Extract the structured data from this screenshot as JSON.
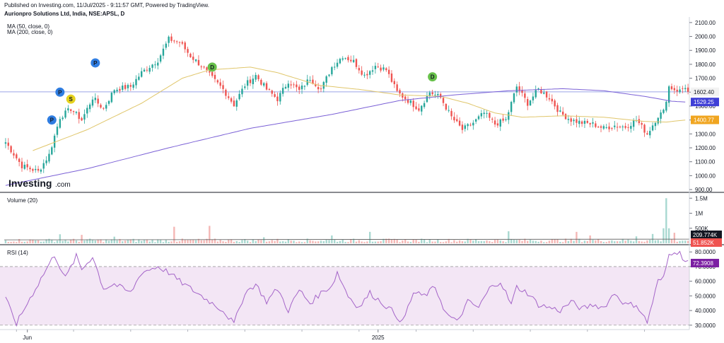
{
  "header": {
    "published": "Published on Investing.com, 11/Jul/2025 - 9:11:57 GMT, Powered by TradingView.",
    "symbol": "Aurionpro Solutions Ltd, India, NSE:APSL, D",
    "ma50": "MA (50, close, 0)",
    "ma200": "MA (200, close, 0)"
  },
  "watermark": {
    "brand": "Investing",
    "suffix": ".com"
  },
  "colors": {
    "up": "#26a69a",
    "down": "#ef5350",
    "ma50": "#e0c66b",
    "ma200": "#7b61d6",
    "rsi": "#a464c8",
    "rsi_band": "#f3e6f5",
    "price_line": "#9aa5e6",
    "lastprice": "#f2f2f2",
    "ma200_tag": "#3f3fd6",
    "ma50_tag": "#f0a520",
    "vol_tag": "#131722",
    "vol_tag2": "#ef5350",
    "rsi_tag": "#7b1fa2"
  },
  "chart_data": [
    {
      "type": "candlestick",
      "panel": "price",
      "ylim": [
        880,
        2140
      ],
      "yticks": [
        "2100.00",
        "2000.00",
        "1900.00",
        "1800.00",
        "1700.00",
        "1600.00",
        "1500.00",
        "1400.00",
        "1300.00",
        "1200.00",
        "1100.00",
        "1000.00",
        "900.00"
      ],
      "ytick_values": [
        2100,
        2000,
        1900,
        1800,
        1700,
        1600,
        1500,
        1400,
        1300,
        1200,
        1100,
        1000,
        900
      ],
      "x_labels": [
        {
          "text": "Jun",
          "index": 8
        },
        {
          "text": "2025",
          "index": 137
        }
      ],
      "bars_total": 252,
      "close_anchors": [
        [
          0,
          1240
        ],
        [
          6,
          1070
        ],
        [
          12,
          1030
        ],
        [
          16,
          1150
        ],
        [
          20,
          1420
        ],
        [
          24,
          1480
        ],
        [
          28,
          1400
        ],
        [
          32,
          1560
        ],
        [
          36,
          1480
        ],
        [
          40,
          1620
        ],
        [
          46,
          1640
        ],
        [
          50,
          1740
        ],
        [
          56,
          1830
        ],
        [
          60,
          1980
        ],
        [
          64,
          1960
        ],
        [
          68,
          1860
        ],
        [
          72,
          1790
        ],
        [
          76,
          1700
        ],
        [
          80,
          1620
        ],
        [
          84,
          1510
        ],
        [
          88,
          1650
        ],
        [
          92,
          1720
        ],
        [
          96,
          1620
        ],
        [
          100,
          1550
        ],
        [
          104,
          1680
        ],
        [
          108,
          1610
        ],
        [
          112,
          1700
        ],
        [
          116,
          1620
        ],
        [
          120,
          1780
        ],
        [
          124,
          1860
        ],
        [
          128,
          1820
        ],
        [
          132,
          1720
        ],
        [
          136,
          1790
        ],
        [
          140,
          1760
        ],
        [
          144,
          1600
        ],
        [
          148,
          1540
        ],
        [
          152,
          1480
        ],
        [
          156,
          1600
        ],
        [
          160,
          1560
        ],
        [
          164,
          1420
        ],
        [
          168,
          1330
        ],
        [
          172,
          1380
        ],
        [
          176,
          1450
        ],
        [
          180,
          1370
        ],
        [
          184,
          1400
        ],
        [
          188,
          1640
        ],
        [
          192,
          1520
        ],
        [
          196,
          1620
        ],
        [
          200,
          1560
        ],
        [
          204,
          1450
        ],
        [
          208,
          1400
        ],
        [
          212,
          1380
        ],
        [
          216,
          1370
        ],
        [
          220,
          1340
        ],
        [
          224,
          1360
        ],
        [
          228,
          1350
        ],
        [
          232,
          1400
        ],
        [
          236,
          1300
        ],
        [
          240,
          1430
        ],
        [
          242,
          1460
        ],
        [
          244,
          1640
        ],
        [
          246,
          1620
        ],
        [
          248,
          1610
        ],
        [
          250,
          1640
        ],
        [
          251,
          1602.4
        ]
      ],
      "markers": [
        {
          "label": "P",
          "index": 17,
          "price": 1400,
          "color": "#2f7de1"
        },
        {
          "label": "P",
          "index": 20,
          "price": 1600,
          "color": "#2f7de1"
        },
        {
          "label": "S",
          "index": 24,
          "price": 1550,
          "color": "#e6d21e"
        },
        {
          "label": "P",
          "index": 33,
          "price": 1810,
          "color": "#2f7de1"
        },
        {
          "label": "D",
          "index": 76,
          "price": 1780,
          "color": "#67c04a"
        },
        {
          "label": "D",
          "index": 157,
          "price": 1710,
          "color": "#67c04a"
        }
      ],
      "series": [
        {
          "name": "MA (50, close, 0)",
          "anchors": [
            [
              10,
              1180
            ],
            [
              30,
              1330
            ],
            [
              50,
              1520
            ],
            [
              65,
              1700
            ],
            [
              75,
              1760
            ],
            [
              90,
              1780
            ],
            [
              100,
              1740
            ],
            [
              115,
              1650
            ],
            [
              130,
              1620
            ],
            [
              145,
              1580
            ],
            [
              160,
              1570
            ],
            [
              170,
              1520
            ],
            [
              180,
              1450
            ],
            [
              190,
              1420
            ],
            [
              205,
              1430
            ],
            [
              220,
              1420
            ],
            [
              235,
              1390
            ],
            [
              243,
              1385
            ],
            [
              250,
              1400
            ]
          ]
        },
        {
          "name": "MA (200, close, 0)",
          "anchors": [
            [
              0,
              930
            ],
            [
              30,
              1050
            ],
            [
              60,
              1200
            ],
            [
              90,
              1340
            ],
            [
              120,
              1440
            ],
            [
              145,
              1540
            ],
            [
              165,
              1580
            ],
            [
              185,
              1610
            ],
            [
              205,
              1625
            ],
            [
              220,
              1610
            ],
            [
              235,
              1570
            ],
            [
              245,
              1535
            ],
            [
              250,
              1529
            ]
          ]
        }
      ],
      "price_tags": [
        {
          "text": "1602.40",
          "value": 1602.4,
          "kind": "last"
        },
        {
          "text": "1529.25",
          "value": 1529.25,
          "kind": "ma200"
        },
        {
          "text": "1400.77",
          "value": 1400.77,
          "kind": "ma50"
        }
      ]
    },
    {
      "type": "bar",
      "panel": "volume",
      "title": "Volume (20)",
      "ylim": [
        0,
        1600000
      ],
      "yticks": [
        "1.5M",
        "1M",
        "500K"
      ],
      "ytick_values": [
        1500000,
        1000000,
        500000
      ],
      "base_volume": 120000,
      "spikes": [
        [
          20,
          300000
        ],
        [
          28,
          280000
        ],
        [
          40,
          220000
        ],
        [
          62,
          550000
        ],
        [
          75,
          580000
        ],
        [
          95,
          200000
        ],
        [
          120,
          260000
        ],
        [
          134,
          380000
        ],
        [
          185,
          400000
        ],
        [
          210,
          380000
        ],
        [
          215,
          260000
        ],
        [
          232,
          230000
        ],
        [
          238,
          310000
        ],
        [
          242,
          500000
        ],
        [
          243,
          1500000
        ],
        [
          244,
          500000
        ],
        [
          246,
          350000
        ]
      ],
      "ma_value": 209774,
      "tags": [
        {
          "text": "209.774K",
          "value": 209774,
          "kind": "vol"
        },
        {
          "text": "51.852K",
          "value": 51852,
          "kind": "vol2"
        }
      ]
    },
    {
      "type": "line",
      "panel": "rsi",
      "title": "RSI (14)",
      "ylim": [
        27,
        83
      ],
      "yticks": [
        "80.0000",
        "70.0000",
        "60.0000",
        "50.0000",
        "40.0000",
        "30.0000"
      ],
      "ytick_values": [
        80,
        70,
        60,
        50,
        40,
        30
      ],
      "band": [
        30,
        70
      ],
      "anchors": [
        [
          0,
          48
        ],
        [
          4,
          31
        ],
        [
          8,
          45
        ],
        [
          14,
          65
        ],
        [
          18,
          78
        ],
        [
          22,
          62
        ],
        [
          26,
          77
        ],
        [
          28,
          68
        ],
        [
          32,
          77
        ],
        [
          36,
          55
        ],
        [
          40,
          58
        ],
        [
          46,
          52
        ],
        [
          50,
          66
        ],
        [
          56,
          70
        ],
        [
          60,
          66
        ],
        [
          64,
          60
        ],
        [
          68,
          55
        ],
        [
          72,
          50
        ],
        [
          76,
          45
        ],
        [
          80,
          40
        ],
        [
          84,
          31
        ],
        [
          88,
          52
        ],
        [
          92,
          58
        ],
        [
          96,
          46
        ],
        [
          100,
          55
        ],
        [
          104,
          40
        ],
        [
          108,
          54
        ],
        [
          112,
          45
        ],
        [
          116,
          52
        ],
        [
          120,
          57
        ],
        [
          122,
          66
        ],
        [
          126,
          50
        ],
        [
          130,
          42
        ],
        [
          134,
          52
        ],
        [
          138,
          46
        ],
        [
          142,
          40
        ],
        [
          146,
          32
        ],
        [
          150,
          52
        ],
        [
          154,
          50
        ],
        [
          158,
          56
        ],
        [
          162,
          38
        ],
        [
          166,
          32
        ],
        [
          170,
          46
        ],
        [
          174,
          42
        ],
        [
          178,
          55
        ],
        [
          182,
          60
        ],
        [
          186,
          44
        ],
        [
          188,
          56
        ],
        [
          192,
          52
        ],
        [
          196,
          44
        ],
        [
          200,
          42
        ],
        [
          204,
          40
        ],
        [
          208,
          46
        ],
        [
          212,
          41
        ],
        [
          216,
          44
        ],
        [
          220,
          42
        ],
        [
          224,
          52
        ],
        [
          228,
          44
        ],
        [
          232,
          44
        ],
        [
          236,
          32
        ],
        [
          240,
          60
        ],
        [
          242,
          62
        ],
        [
          244,
          78
        ],
        [
          246,
          81
        ],
        [
          248,
          79
        ],
        [
          250,
          74
        ]
      ],
      "tags": [
        {
          "text": "72.3908",
          "value": 72.3908,
          "kind": "rsi"
        }
      ]
    }
  ]
}
